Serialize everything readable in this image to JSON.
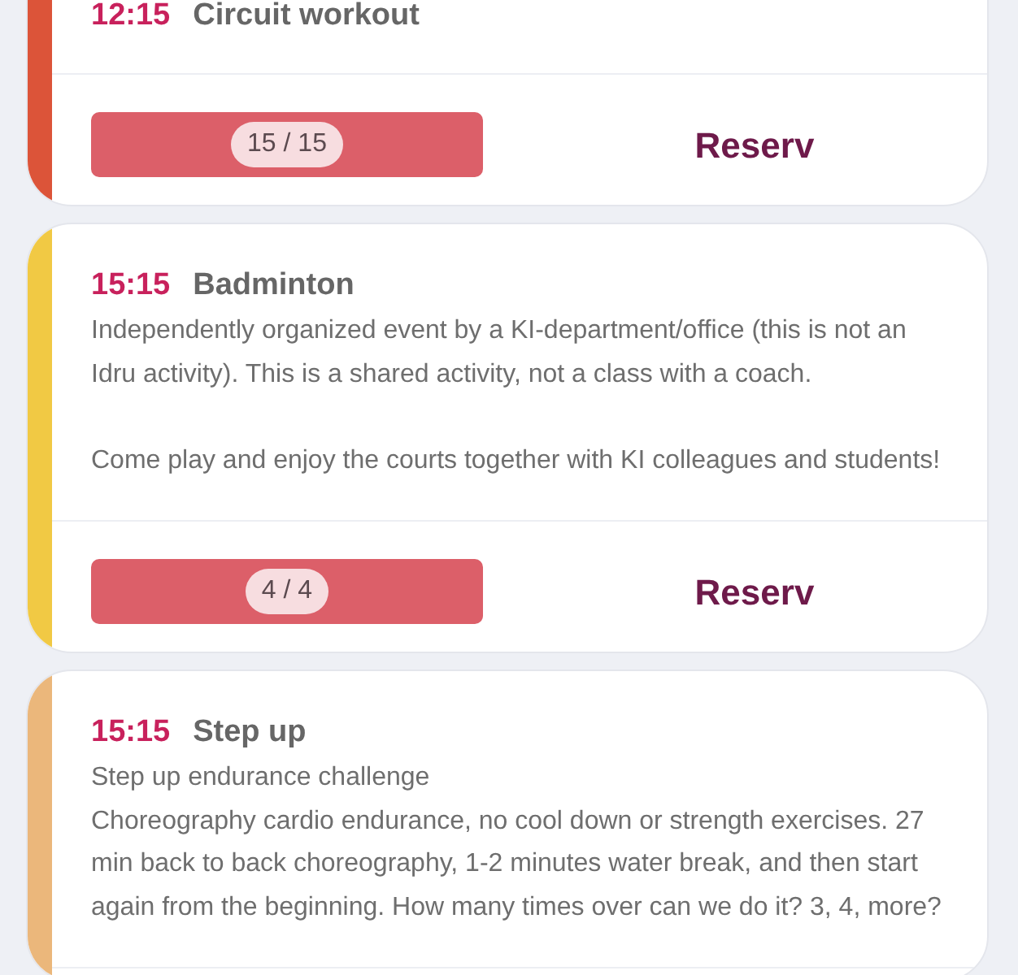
{
  "classes": [
    {
      "time": "12:15",
      "title": "Circuit workout",
      "color": "#dc5439",
      "capacity": {
        "count": "15 / 15",
        "full": true
      },
      "action": "Reserv"
    },
    {
      "time": "15:15",
      "title": "Badminton",
      "color": "#f1c944",
      "description": "Independently organized event by a KI-department/office (this is not an Idru activity). This is a shared activity, not a class with a coach.\n\nCome play and enjoy the courts together with KI colleagues and students!",
      "capacity": {
        "count": "4 / 4",
        "full": true
      },
      "action": "Reserv"
    },
    {
      "time": "15:15",
      "title": "Step up",
      "color": "#ebb77b",
      "description": "Step up endurance challenge\nChoreography cardio endurance, no cool down or strength exercises. 27 min back to back choreography, 1-2 minutes water break, and then start again from the beginning. How many times over can we do it? 3, 4, more?"
    }
  ]
}
